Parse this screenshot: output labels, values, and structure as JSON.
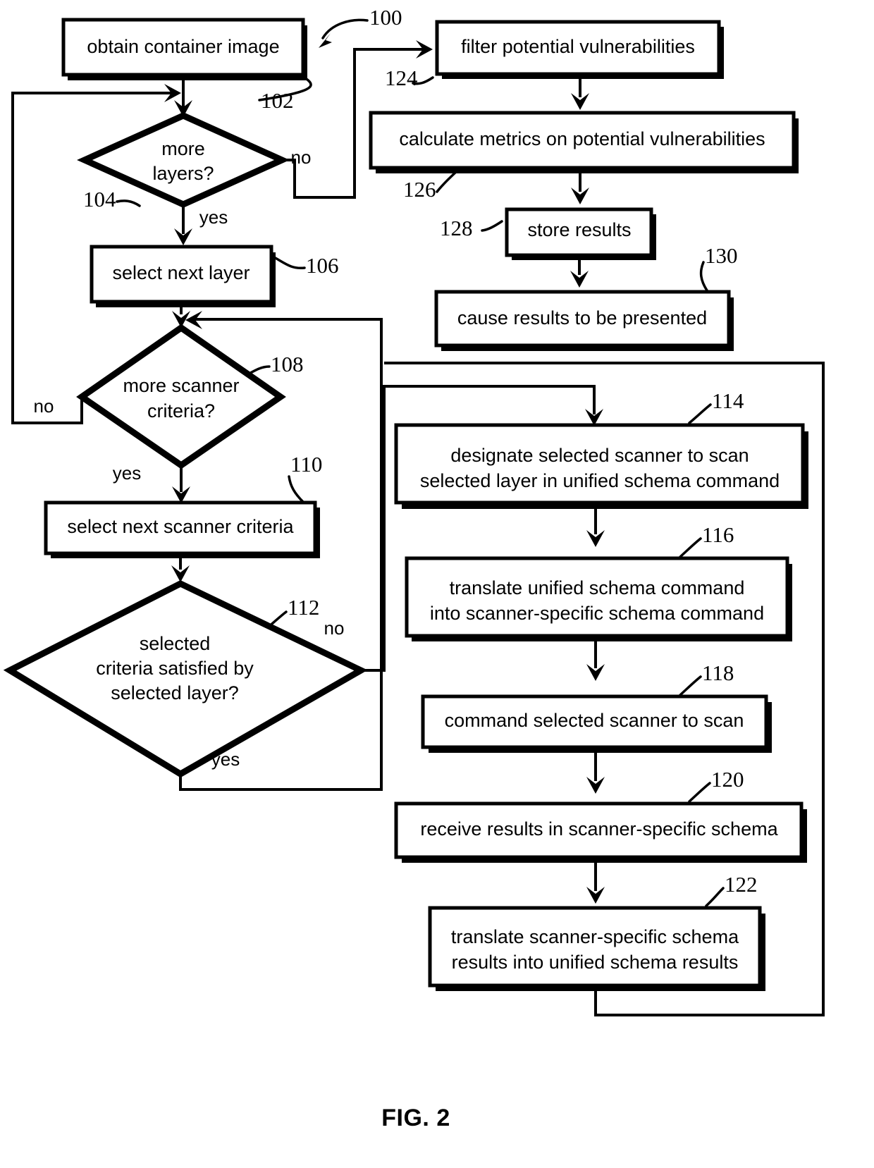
{
  "figure": {
    "caption": "FIG. 2",
    "diagram_reference": "100"
  },
  "nodes": [
    {
      "id": "102",
      "ref": "102",
      "shape": "process",
      "text_lines": [
        "obtain container image"
      ]
    },
    {
      "id": "104",
      "ref": "104",
      "shape": "decision",
      "text_lines": [
        "more",
        "layers?"
      ]
    },
    {
      "id": "106",
      "ref": "106",
      "shape": "process",
      "text_lines": [
        "select next layer"
      ]
    },
    {
      "id": "108",
      "ref": "108",
      "shape": "decision",
      "text_lines": [
        "more scanner",
        "criteria?"
      ]
    },
    {
      "id": "110",
      "ref": "110",
      "shape": "process",
      "text_lines": [
        "select next scanner criteria"
      ]
    },
    {
      "id": "112",
      "ref": "112",
      "shape": "decision",
      "text_lines": [
        "selected",
        "criteria satisfied by",
        "selected layer?"
      ]
    },
    {
      "id": "114",
      "ref": "114",
      "shape": "process",
      "text_lines": [
        "designate selected scanner to scan",
        "selected layer in unified schema command"
      ]
    },
    {
      "id": "116",
      "ref": "116",
      "shape": "process",
      "text_lines": [
        "translate unified schema command",
        "into scanner-specific schema command"
      ]
    },
    {
      "id": "118",
      "ref": "118",
      "shape": "process",
      "text_lines": [
        "command selected scanner to scan"
      ]
    },
    {
      "id": "120",
      "ref": "120",
      "shape": "process",
      "text_lines": [
        "receive results in scanner-specific schema"
      ]
    },
    {
      "id": "122",
      "ref": "122",
      "shape": "process",
      "text_lines": [
        "translate scanner-specific schema",
        "results into unified schema results"
      ]
    },
    {
      "id": "124",
      "ref": "124",
      "shape": "process",
      "text_lines": [
        "filter potential vulnerabilities"
      ]
    },
    {
      "id": "126",
      "ref": "126",
      "shape": "process",
      "text_lines": [
        "calculate metrics on potential vulnerabilities"
      ]
    },
    {
      "id": "128",
      "ref": "128",
      "shape": "process",
      "text_lines": [
        "store results"
      ]
    },
    {
      "id": "130",
      "ref": "130",
      "shape": "process",
      "text_lines": [
        "cause results to be presented"
      ]
    }
  ],
  "edge_labels": {
    "layers_no": "no",
    "layers_yes": "yes",
    "criteria_no": "no",
    "criteria_yes": "yes",
    "satisfied_no": "no",
    "satisfied_yes": "yes"
  }
}
